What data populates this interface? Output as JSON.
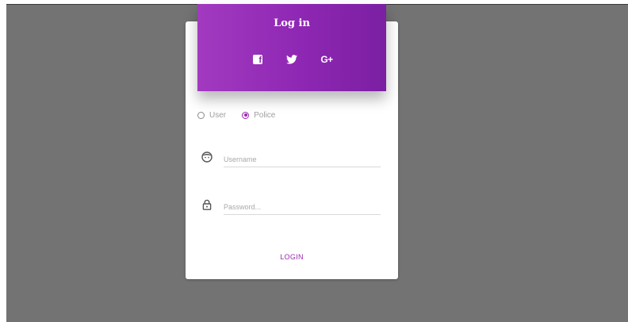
{
  "login_card": {
    "title": "Log in",
    "social": [
      {
        "icon": "facebook-icon"
      },
      {
        "icon": "twitter-icon"
      },
      {
        "icon": "google-plus-icon",
        "glyph": "G+"
      }
    ],
    "role_options": [
      {
        "label": "User",
        "checked": false
      },
      {
        "label": "Police",
        "checked": true
      }
    ],
    "username": {
      "value": "",
      "placeholder": "Username",
      "icon": "user-face-icon"
    },
    "password": {
      "value": "",
      "placeholder": "Password...",
      "icon": "lock-icon"
    },
    "login_label": "LOGIN"
  },
  "colors": {
    "accent": "#9c27b0",
    "header_gradient_start": "#a23ac0",
    "header_gradient_end": "#7b1fa2",
    "backdrop": "#737373",
    "card": "#ffffff"
  }
}
